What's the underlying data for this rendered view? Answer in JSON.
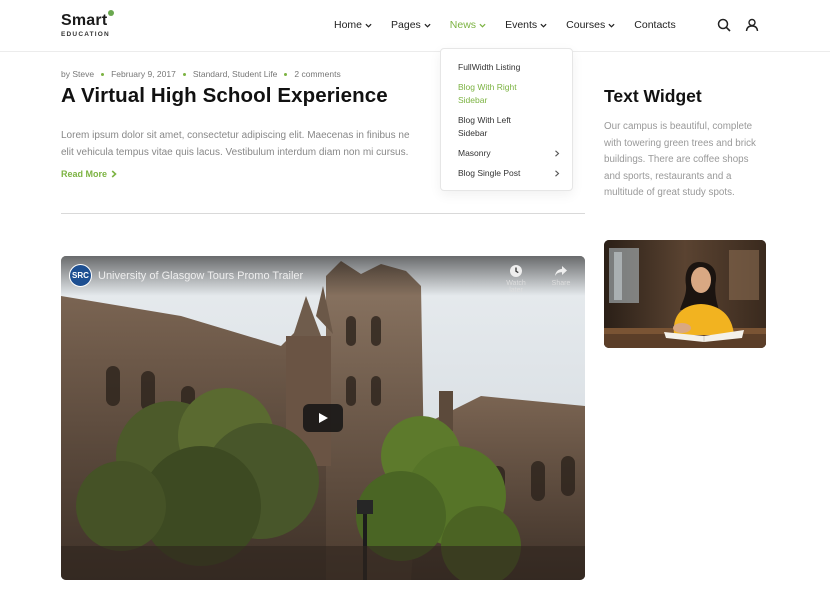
{
  "brand": {
    "name": "Smart",
    "tagline": "EDUCATION"
  },
  "nav": {
    "items": [
      {
        "label": "Home",
        "has_dropdown": true
      },
      {
        "label": "Pages",
        "has_dropdown": true
      },
      {
        "label": "News",
        "has_dropdown": true,
        "active": true
      },
      {
        "label": "Events",
        "has_dropdown": true
      },
      {
        "label": "Courses",
        "has_dropdown": true
      },
      {
        "label": "Contacts",
        "has_dropdown": false
      }
    ],
    "dropdown": [
      {
        "label": "FullWidth Listing"
      },
      {
        "label": "Blog With Right Sidebar",
        "active": true
      },
      {
        "label": "Blog With Left Sidebar"
      },
      {
        "label": "Masonry",
        "has_submenu": true
      },
      {
        "label": "Blog Single Post",
        "has_submenu": true
      }
    ],
    "icons": {
      "search": "search-icon",
      "user": "user-icon"
    }
  },
  "post": {
    "meta": {
      "author": "by Steve",
      "date": "February 9, 2017",
      "categories": "Standard, Student Life",
      "comments": "2 comments"
    },
    "title": "A Virtual High School Experience",
    "excerpt_line1": "Lorem ipsum dolor sit amet, consectetur adipiscing elit. Maecenas in finibus ne",
    "excerpt_line2": "elit vehicula tempus vitae quis lacus. Vestibulum interdum diam non mi cursus.",
    "read_more": "Read More"
  },
  "video": {
    "channel": "SRC",
    "title": "University of Glasgow Tours Promo Trailer",
    "watch_later": "Watch later",
    "share": "Share"
  },
  "sidebar": {
    "title": "Text Widget",
    "text": "Our campus is beautiful, complete with towering green trees and brick buildings. There are coffee shops and sports, restaurants and a multitude of great study spots."
  },
  "colors": {
    "accent": "#7cb342",
    "text": "#111111",
    "muted": "#999999"
  }
}
